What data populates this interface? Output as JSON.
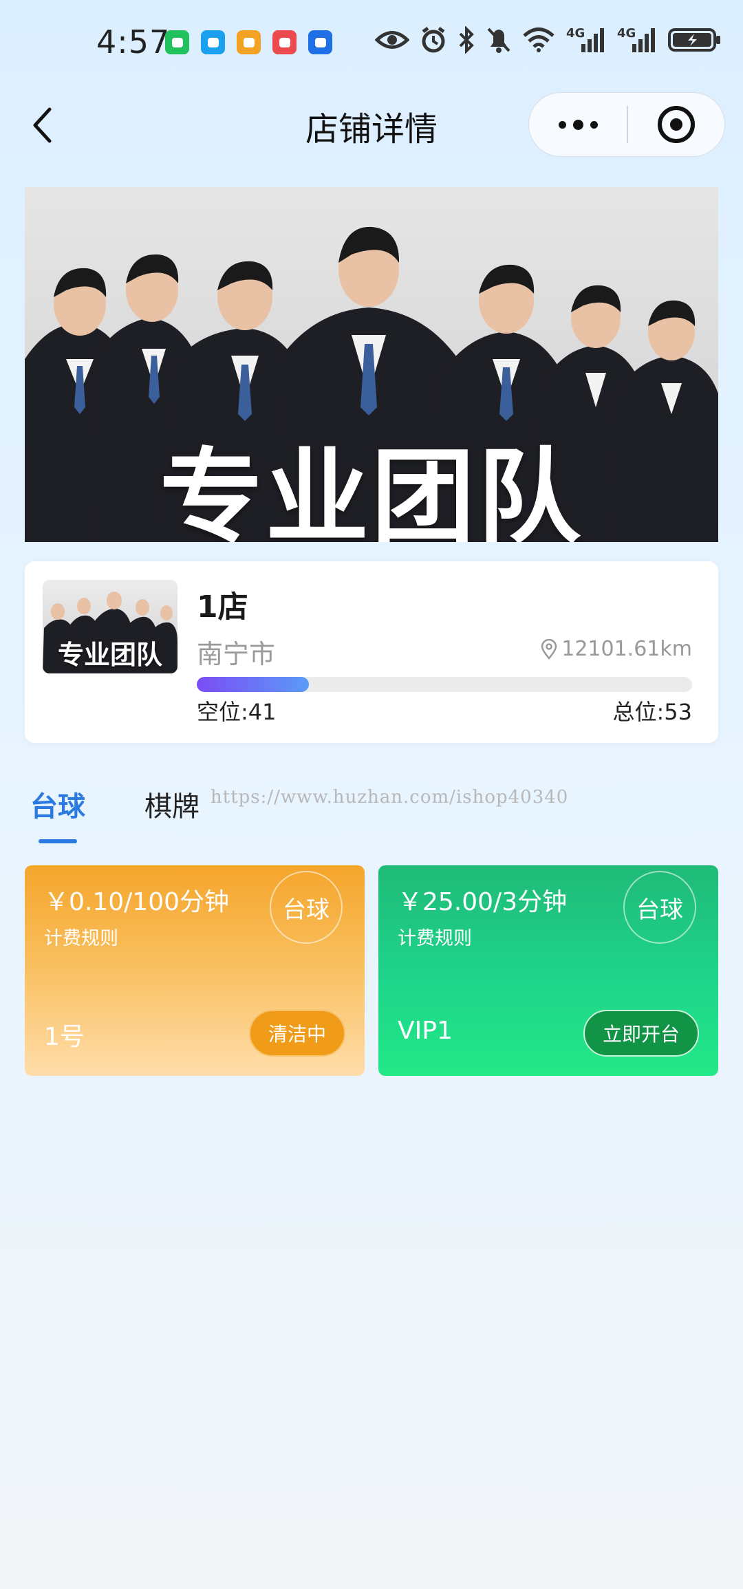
{
  "status_bar": {
    "time": "4:57",
    "network_labels": [
      "4G",
      "4G"
    ],
    "app_icons": [
      {
        "name": "wechat-icon",
        "color": "#21c15d"
      },
      {
        "name": "message-icon",
        "color": "#1aa0ee"
      },
      {
        "name": "app-icon",
        "color": "#f3a224"
      },
      {
        "name": "book-icon",
        "color": "#ec4a4f"
      },
      {
        "name": "bulb-icon",
        "color": "#1f6fe6"
      }
    ]
  },
  "nav": {
    "title": "店铺详情"
  },
  "banner": {
    "caption": "专业团队"
  },
  "store": {
    "name": "1店",
    "city": "南宁市",
    "distance": "12101.61km",
    "empty_seats": "空位:41",
    "total_seats": "总位:53",
    "occupancy_fraction": 0.226,
    "thumb_caption": "专业团队"
  },
  "tabs": [
    {
      "label": "台球",
      "active": true
    },
    {
      "label": "棋牌",
      "active": false
    }
  ],
  "watermark": "https://www.huzhan.com/ishop40340",
  "tables": [
    {
      "price": "￥0.10/100分钟",
      "rule_label": "计费规则",
      "badge": "台球",
      "number": "1号",
      "status": "清洁中",
      "color": "#f5a52b"
    },
    {
      "price": "￥25.00/3分钟",
      "rule_label": "计费规则",
      "badge": "台球",
      "number": "VIP1",
      "status": "立即开台",
      "color": "#1fc77f"
    }
  ]
}
